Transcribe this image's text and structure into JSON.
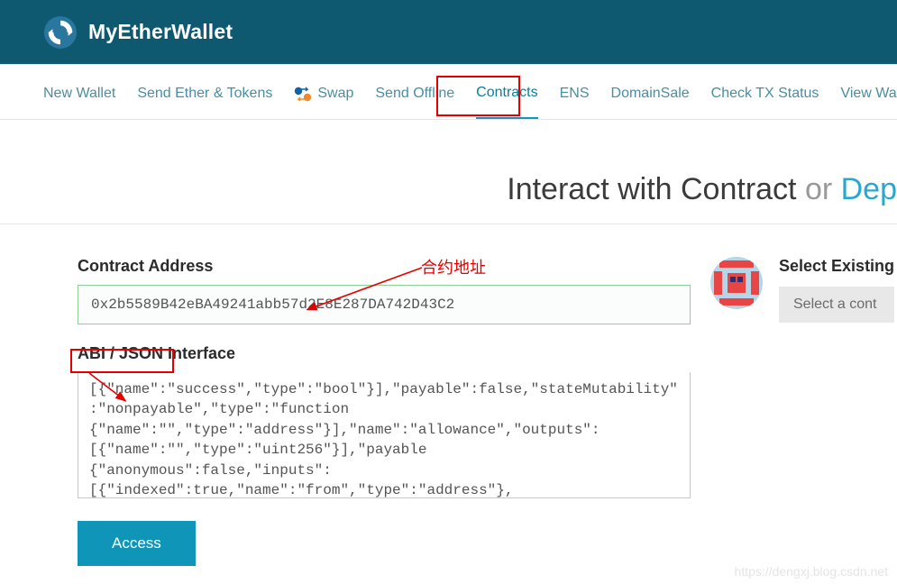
{
  "brand": "MyEtherWallet",
  "nav": {
    "items": [
      {
        "label": "New Wallet"
      },
      {
        "label": "Send Ether & Tokens"
      },
      {
        "label": "Swap"
      },
      {
        "label": "Send Offline"
      },
      {
        "label": "Contracts"
      },
      {
        "label": "ENS"
      },
      {
        "label": "DomainSale"
      },
      {
        "label": "Check TX Status"
      },
      {
        "label": "View Wallet Info"
      }
    ],
    "activeIndex": 4
  },
  "title": {
    "main": "Interact with Contract",
    "or": " or ",
    "dep": "Dep"
  },
  "form": {
    "addressLabel": "Contract Address",
    "addressValue": "0x2b5589B42eBA49241abb57d2E8E287DA742D43C2",
    "abiLabel": "ABI / JSON Interface",
    "abiValue": "[{\"name\":\"success\",\"type\":\"bool\"}],\"payable\":false,\"stateMutability\":\"nonpayable\",\"type\":\"function\n{\"name\":\"\",\"type\":\"address\"}],\"name\":\"allowance\",\"outputs\":[{\"name\":\"\",\"type\":\"uint256\"}],\"payable\n{\"anonymous\":false,\"inputs\":[{\"indexed\":true,\"name\":\"from\",\"type\":\"address\"},{\"indexed\":true,\"name\n{\"indexed\":false,\"name\":\"value\",\"type\":\"uint256\"}],\"name\":\"Transfer\",\"type\":\"event\"},{\"anonymous\":\n{\"indexed\":true,\"name\":\"_spender\",\"type\":\"address\"},{\"indexed\":false,\"name\":\"_value\",\"type\":\"uint2\n{\"anonymous\":false,\"inputs\":[{\"indexed\":true,\"name\":\"from\",\"type\":\"address\"},{\"indexed\":false,\"nam",
    "accessBtn": "Access"
  },
  "side": {
    "selectLabel": "Select Existing",
    "selectValue": "Select a cont"
  },
  "annotations": {
    "contractAddress": "合约地址"
  },
  "watermark": "https://dengxj.blog.csdn.net"
}
